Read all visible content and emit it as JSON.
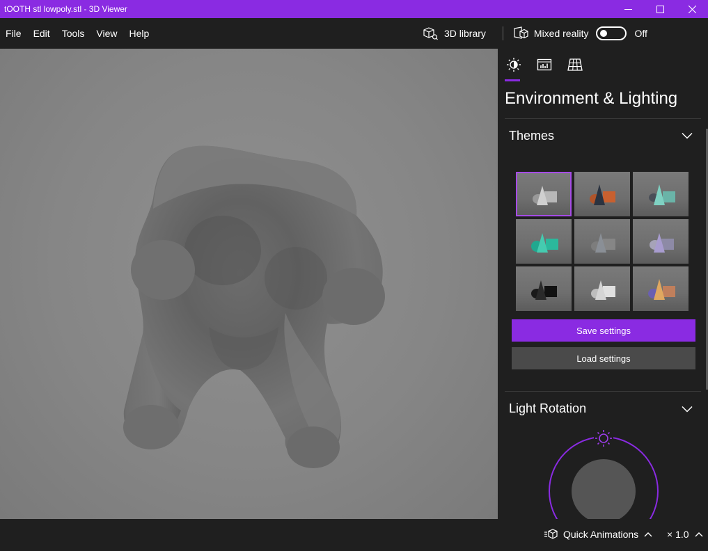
{
  "window": {
    "title": "tOOTH stl lowpoly.stl - 3D Viewer",
    "accent_color": "#8a2be2"
  },
  "menu": {
    "items": [
      "File",
      "Edit",
      "Tools",
      "View",
      "Help"
    ],
    "library_label": "3D library",
    "mixed_reality_label": "Mixed reality",
    "mixed_reality_state": "Off"
  },
  "panel": {
    "tabs": [
      "environment-lighting-icon",
      "stats-icon",
      "grid-icon"
    ],
    "heading": "Environment & Lighting",
    "themes": {
      "title": "Themes",
      "selected_index": 0,
      "save_label": "Save settings",
      "load_label": "Load settings"
    },
    "light_rotation": {
      "title": "Light Rotation"
    }
  },
  "status": {
    "quick_animations_label": "Quick Animations",
    "speed_label": "× 1.0"
  }
}
